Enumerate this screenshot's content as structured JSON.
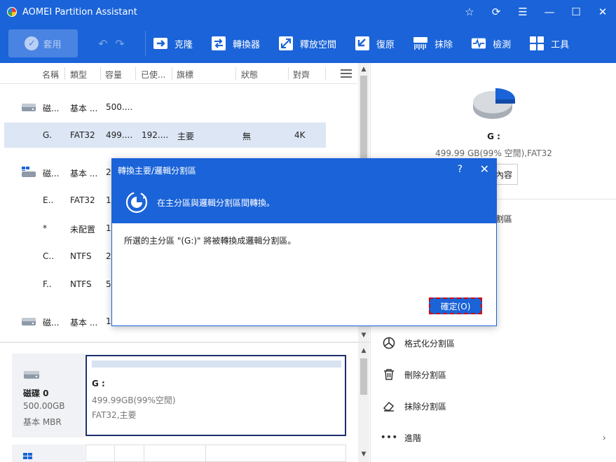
{
  "app": {
    "title": "AOMEI Partition Assistant"
  },
  "titlebar": {
    "controls": [
      "star-icon",
      "refresh-icon",
      "menu-icon",
      "minimize-icon",
      "maximize-icon",
      "close-icon"
    ]
  },
  "toolbar": {
    "apply": "套用",
    "items": [
      {
        "label": "克隆",
        "icon": "clone-icon"
      },
      {
        "label": "轉換器",
        "icon": "convert-icon"
      },
      {
        "label": "釋放空間",
        "icon": "free-space-icon"
      },
      {
        "label": "復原",
        "icon": "recovery-icon"
      },
      {
        "label": "抹除",
        "icon": "wipe-icon"
      },
      {
        "label": "檢測",
        "icon": "test-icon"
      },
      {
        "label": "工具",
        "icon": "tools-icon"
      }
    ]
  },
  "columns": [
    "名稱",
    "類型",
    "容量",
    "已使...",
    "旗標",
    "狀態",
    "對齊"
  ],
  "rows": [
    {
      "name": "磁...",
      "type": "基本 ...",
      "cap": "500....",
      "used": "",
      "flag": "",
      "status": "",
      "align": "",
      "kind": "disk"
    },
    {
      "name": "G.",
      "type": "FAT32",
      "cap": "499....",
      "used": "192....",
      "flag": "主要",
      "status": "無",
      "align": "4K",
      "kind": "part",
      "selected": true
    },
    {
      "name": "磁...",
      "type": "基本 ...",
      "cap": "2",
      "kind": "disk-win"
    },
    {
      "name": "E..",
      "type": "FAT32",
      "cap": "1",
      "kind": "part"
    },
    {
      "name": "*",
      "type": "未配置",
      "cap": "1",
      "kind": "part"
    },
    {
      "name": "C..",
      "type": "NTFS",
      "cap": "2",
      "kind": "part"
    },
    {
      "name": "F..",
      "type": "NTFS",
      "cap": "5",
      "kind": "part"
    },
    {
      "name": "磁...",
      "type": "基本 ...",
      "cap": "1",
      "kind": "disk"
    }
  ],
  "diskmap": {
    "disk_name": "磁碟 0",
    "disk_size": "500.00GB",
    "disk_type": "基本 MBR",
    "part_name": "G :",
    "part_size": "499.99GB(99%空閒)",
    "part_fs": "FAT32,主要"
  },
  "right": {
    "part_name": "G :",
    "part_info": "499.99 GB(99% 空閒),FAT32",
    "props_btn": "內容",
    "op_fragment": "割區",
    "ops": [
      {
        "label": "格式化分割區",
        "icon": "format-icon"
      },
      {
        "label": "刪除分割區",
        "icon": "delete-icon"
      },
      {
        "label": "抹除分割區",
        "icon": "eraser-icon"
      },
      {
        "label": "進階",
        "icon": "more-icon"
      }
    ]
  },
  "dialog": {
    "title": "轉換主要/邏輯分割區",
    "help": "?",
    "banner": "在主分區與邏輯分割區間轉換。",
    "message": "所選的主分區 \"(G:)\" 將被轉換成邏輯分割區。",
    "ok": "確定(O)"
  },
  "colors": {
    "brand": "#1a63d8",
    "selection": "#dce6f4",
    "ok_border": "#d50000"
  }
}
